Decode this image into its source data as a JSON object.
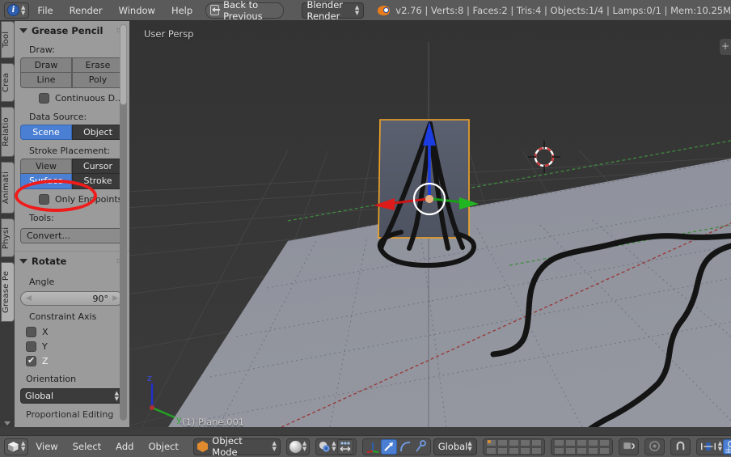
{
  "topbar": {
    "editor_icon": "info-icon",
    "menus": [
      "File",
      "Render",
      "Window",
      "Help"
    ],
    "back_button": {
      "label": "Back to Previous",
      "icon": "back-arrow-icon"
    },
    "render_engine": {
      "value": "Blender Render",
      "icon": "chevron-updown-icon"
    },
    "logo_icon": "blender-logo-icon",
    "stats": "v2.76 | Verts:8 | Faces:2 | Tris:4 | Objects:1/4 | Lamps:0/1 | Mem:10.25M"
  },
  "vertical_tabs": [
    {
      "label": "Tool",
      "active": false
    },
    {
      "label": "Crea",
      "active": false
    },
    {
      "label": "Relatio",
      "active": false
    },
    {
      "label": "Animati",
      "active": false
    },
    {
      "label": "Physi",
      "active": false
    },
    {
      "label": "Grease Pe",
      "active": true
    }
  ],
  "grease_panel": {
    "title": "Grease Pencil",
    "draw_label": "Draw:",
    "draw_buttons": [
      "Draw",
      "Erase",
      "Line",
      "Poly"
    ],
    "continuous": {
      "label": "Continuous D...",
      "checked": false
    },
    "data_source_label": "Data Source:",
    "data_source": {
      "options": [
        "Scene",
        "Object"
      ],
      "selected": "Scene"
    },
    "stroke_placement_label": "Stroke Placement:",
    "stroke_placement": {
      "options": [
        "View",
        "Cursor",
        "Surface",
        "Stroke"
      ],
      "selected": "Surface"
    },
    "only_endpoints": {
      "label": "Only Endpoints",
      "checked": false
    },
    "tools_label": "Tools:",
    "convert_button": "Convert..."
  },
  "rotate_panel": {
    "title": "Rotate",
    "angle_label": "Angle",
    "angle_value": "90°",
    "constraint_label": "Constraint Axis",
    "axes": [
      {
        "label": "X",
        "checked": false
      },
      {
        "label": "Y",
        "checked": false
      },
      {
        "label": "Z",
        "checked": true
      }
    ],
    "orientation_label": "Orientation",
    "orientation_value": "Global",
    "proportional_label": "Proportional Editing"
  },
  "annotation": {
    "type": "red-ellipse",
    "color": "#f01b1b",
    "targets": "Surface"
  },
  "viewport": {
    "perspective_label": "User Persp",
    "object_label": "(1) Plane.001",
    "axis_gizmo": {
      "z": "z",
      "y": "y"
    },
    "npanel_tab": "+",
    "colors": {
      "sky_top": "#2f2f2f",
      "floor": "#8b8e99",
      "stroke": "#121212",
      "selection_outline": "#f5a623",
      "axis_x": "#a63a3a",
      "axis_y": "#3d8a3d",
      "manip_z": "#1b3ce0"
    }
  },
  "bottombar": {
    "editor_type_icon": "3d-view-icon",
    "menus": [
      "View",
      "Select",
      "Add",
      "Object"
    ],
    "mode": {
      "value": "Object Mode",
      "icon": "object-cube-icon"
    },
    "shading": {
      "icon": "shading-sphere-icon"
    },
    "pivot": {
      "icon": "pivot-icon"
    },
    "manipulator_icons": [
      "translate-icon",
      "rotate-icon",
      "scale-icon"
    ],
    "transform_orientation": "Global",
    "extra_icons": [
      "snap-magnet-icon",
      "proportional-falloff-icon",
      "render-preview-icon",
      "render-animation-icon"
    ]
  }
}
